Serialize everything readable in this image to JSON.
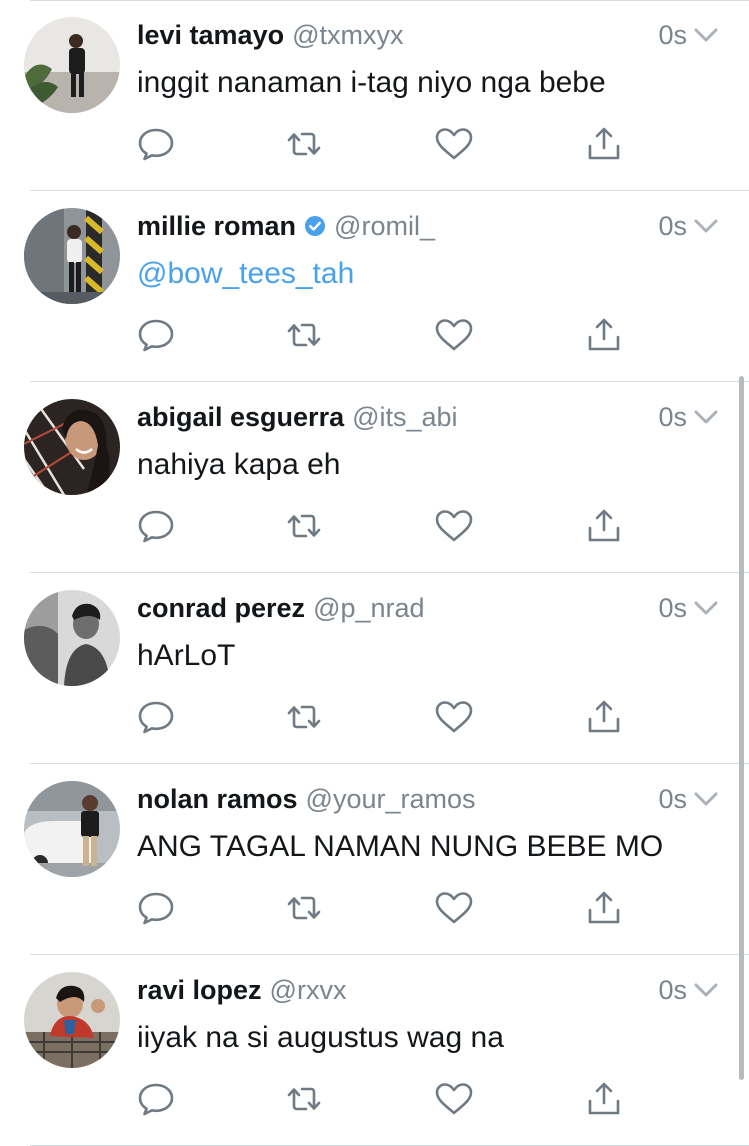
{
  "tweets": [
    {
      "name": "levi tamayo",
      "handle": "@txmxyx",
      "time": "0s",
      "text": "inggit nanaman i-tag niyo nga bebe",
      "verified": false,
      "is_link": false,
      "avatar": "avatar-levi"
    },
    {
      "name": "millie roman",
      "handle": "@romil_",
      "time": "0s",
      "text": "@bow_tees_tah",
      "verified": true,
      "is_link": true,
      "avatar": "avatar-millie"
    },
    {
      "name": "abigail esguerra",
      "handle": "@its_abi",
      "time": "0s",
      "text": "nahiya kapa eh",
      "verified": false,
      "is_link": false,
      "avatar": "avatar-abigail"
    },
    {
      "name": "conrad perez",
      "handle": "@p_nrad",
      "time": "0s",
      "text": "hArLoT",
      "verified": false,
      "is_link": false,
      "avatar": "avatar-conrad"
    },
    {
      "name": "nolan ramos",
      "handle": "@your_ramos",
      "time": "0s",
      "text": "ANG TAGAL NAMAN NUNG BEBE MO",
      "verified": false,
      "is_link": false,
      "avatar": "avatar-nolan"
    },
    {
      "name": "ravi lopez",
      "handle": "@rxvx",
      "time": "0s",
      "text": "iiyak na si augustus wag na",
      "verified": false,
      "is_link": false,
      "avatar": "avatar-ravi"
    }
  ],
  "icons": {
    "reply": "reply-icon",
    "retweet": "retweet-icon",
    "like": "heart-icon",
    "share": "share-icon",
    "caret": "chevron-down-icon",
    "verified": "verified-badge-icon"
  },
  "colors": {
    "text": "#14171a",
    "secondary": "#7b858e",
    "link": "#4aa1eb",
    "divider": "#d8dde1",
    "verified": "#4aa1eb"
  }
}
